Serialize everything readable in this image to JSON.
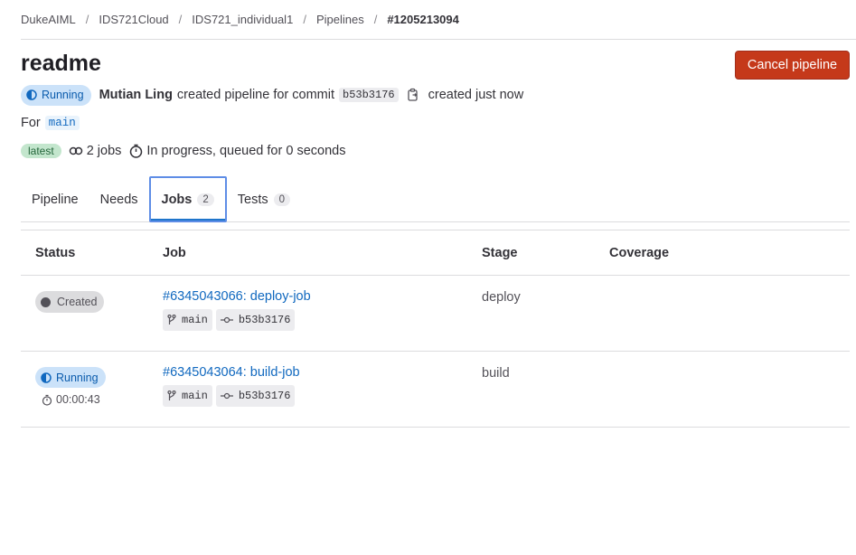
{
  "breadcrumb": {
    "items": [
      "DukeAIML",
      "IDS721Cloud",
      "IDS721_individual1",
      "Pipelines"
    ],
    "current": "#1205213094"
  },
  "header": {
    "title": "readme",
    "cancel_label": "Cancel pipeline"
  },
  "meta": {
    "status": "Running",
    "author": "Mutian Ling",
    "action_text": "created pipeline for commit",
    "commit_sha": "b53b3176",
    "created_text": "created just now",
    "for_label": "For",
    "ref": "main"
  },
  "info": {
    "latest_label": "latest",
    "jobs_text": "2 jobs",
    "progress_text": "In progress, queued for 0 seconds"
  },
  "tabs": [
    {
      "label": "Pipeline",
      "count": null
    },
    {
      "label": "Needs",
      "count": null
    },
    {
      "label": "Jobs",
      "count": "2"
    },
    {
      "label": "Tests",
      "count": "0"
    }
  ],
  "table": {
    "headers": [
      "Status",
      "Job",
      "Stage",
      "Coverage"
    ],
    "rows": [
      {
        "status": "Created",
        "duration": "",
        "job": "#6345043066: deploy-job",
        "ref": "main",
        "sha": "b53b3176",
        "stage": "deploy"
      },
      {
        "status": "Running",
        "duration": "00:00:43",
        "job": "#6345043064: build-job",
        "ref": "main",
        "sha": "b53b3176",
        "stage": "build"
      }
    ]
  },
  "colors": {
    "cancel_button": "#c5391a",
    "running_badge_bg": "#cbe2f9",
    "link": "#1068bf",
    "latest_badge_bg": "#c3e6cd"
  }
}
